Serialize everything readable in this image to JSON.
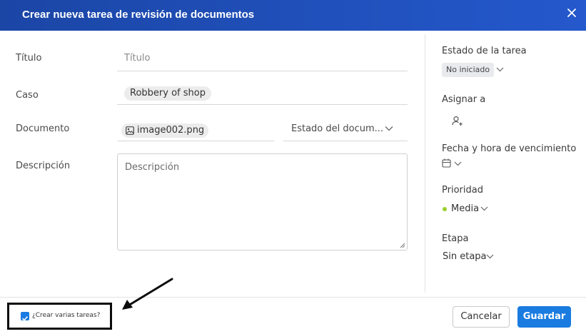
{
  "dialog": {
    "title": "Crear nueva tarea de revisión de documentos"
  },
  "form": {
    "title_label": "Título",
    "title_placeholder": "Título",
    "case_label": "Caso",
    "case_value": "Robbery of shop",
    "document_label": "Documento",
    "document_value": "image002.png",
    "document_status_placeholder": "Estado del docum...",
    "description_label": "Descripción",
    "description_placeholder": "Descripción"
  },
  "sidebar": {
    "status_label": "Estado de la tarea",
    "status_value": "No iniciado",
    "assign_label": "Asignar a",
    "due_label": "Fecha y hora de vencimiento",
    "priority_label": "Prioridad",
    "priority_value": "Media",
    "priority_color": "#9bcf2c",
    "stage_label": "Etapa",
    "stage_value": "Sin etapa"
  },
  "footer": {
    "multi_task_label": "¿Crear varias tareas?",
    "multi_task_checked": true,
    "cancel_label": "Cancelar",
    "save_label": "Guardar"
  },
  "colors": {
    "header": "#2458cc",
    "primary": "#1a7be0"
  }
}
